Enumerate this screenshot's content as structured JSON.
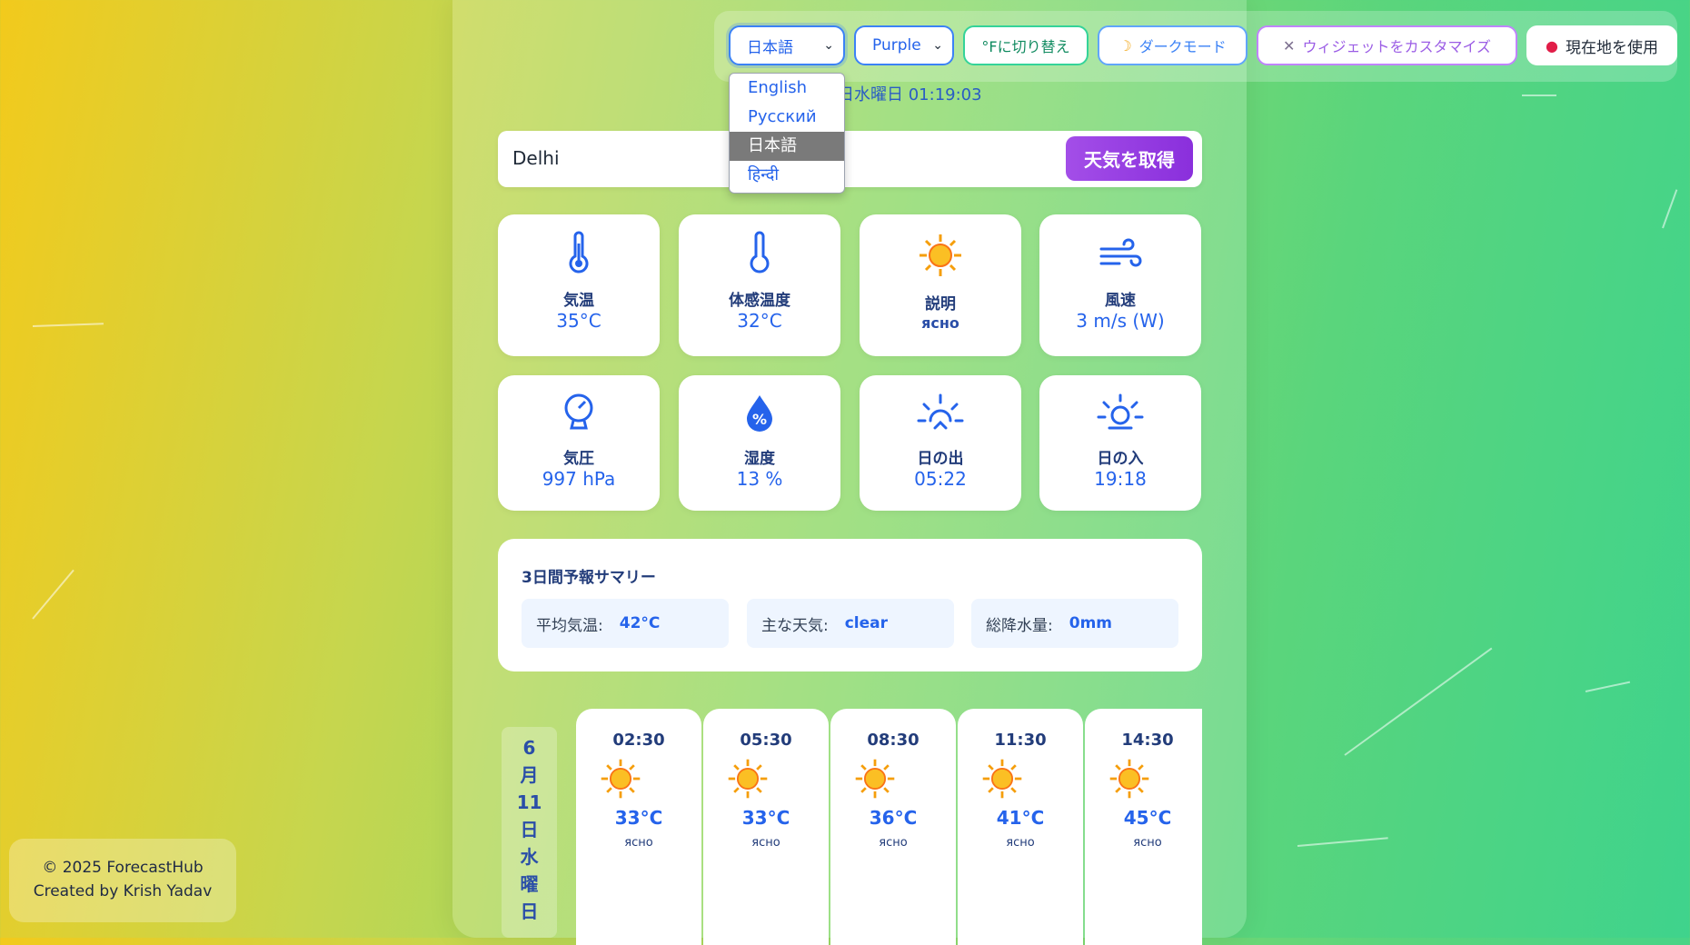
{
  "toolbar": {
    "language_value": "日本語",
    "theme_value": "Purple",
    "unit_toggle_label": "°Fに切り替え",
    "dark_mode_label": "ダークモード",
    "customize_label": "ウィジェットをカスタマイズ",
    "location_label": "現在地を使用",
    "icons": {
      "dark_mode": "crescent-moon-icon",
      "customize": "tools-icon",
      "location": "pin-icon"
    }
  },
  "language_dropdown": {
    "options": [
      "English",
      "Русский",
      "日本語",
      "हिन्दी"
    ],
    "selected": "日本語"
  },
  "datetime_text": "日水曜日 01:19:03",
  "search": {
    "value": "Delhi",
    "button_label": "天気を取得"
  },
  "current": [
    {
      "label": "気温",
      "value": "35°C",
      "icon": "thermometer-icon"
    },
    {
      "label": "体感温度",
      "value": "32°C",
      "icon": "thermometer-icon"
    },
    {
      "label": "説明",
      "value": "ясно",
      "icon": "sun-icon"
    },
    {
      "label": "風速",
      "value": "3 m/s (W)",
      "icon": "wind-icon"
    },
    {
      "label": "気圧",
      "value": "997 hPa",
      "icon": "gauge-icon"
    },
    {
      "label": "湿度",
      "value": "13 %",
      "icon": "humidity-drop-icon"
    },
    {
      "label": "日の出",
      "value": "05:22",
      "icon": "sunrise-icon"
    },
    {
      "label": "日の入",
      "value": "19:18",
      "icon": "sunset-icon"
    }
  ],
  "summary": {
    "title": "3日間予報サマリー",
    "items": [
      {
        "label": "平均気温:",
        "value": "42°C"
      },
      {
        "label": "主な天気:",
        "value": "clear"
      },
      {
        "label": "総降水量:",
        "value": "0mm"
      }
    ]
  },
  "forecast_day": {
    "label_chars": [
      "6",
      "月",
      "11",
      "日",
      "水",
      "曜",
      "日"
    ]
  },
  "hourly": [
    {
      "time": "02:30",
      "temp": "33°C",
      "desc": "ясно"
    },
    {
      "time": "05:30",
      "temp": "33°C",
      "desc": "ясно"
    },
    {
      "time": "08:30",
      "temp": "36°C",
      "desc": "ясно"
    },
    {
      "time": "11:30",
      "temp": "41°C",
      "desc": "ясно"
    },
    {
      "time": "14:30",
      "temp": "45°C",
      "desc": "ясно"
    }
  ],
  "footer": {
    "copyright": "© 2025 ForecastHub",
    "credit": "Created by Krish Yadav"
  },
  "colors": {
    "accent_blue": "#2563eb",
    "button_purple": "#9b3fe6",
    "label_navy": "#223c7a"
  }
}
